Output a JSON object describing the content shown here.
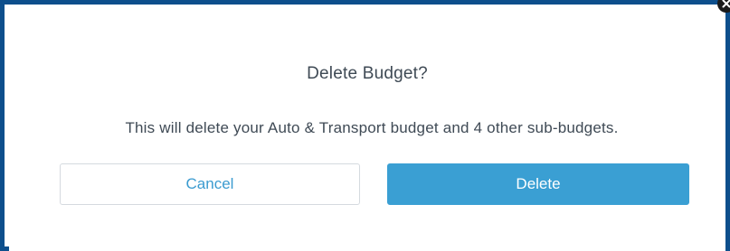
{
  "dialog": {
    "title": "Delete Budget?",
    "message": "This will delete your Auto & Transport budget and 4 other sub-budgets.",
    "cancel_label": "Cancel",
    "delete_label": "Delete",
    "close_icon": "close-icon"
  },
  "colors": {
    "frame_border": "#0d4f8c",
    "primary": "#3a9fd3",
    "text": "#3f4a55"
  }
}
